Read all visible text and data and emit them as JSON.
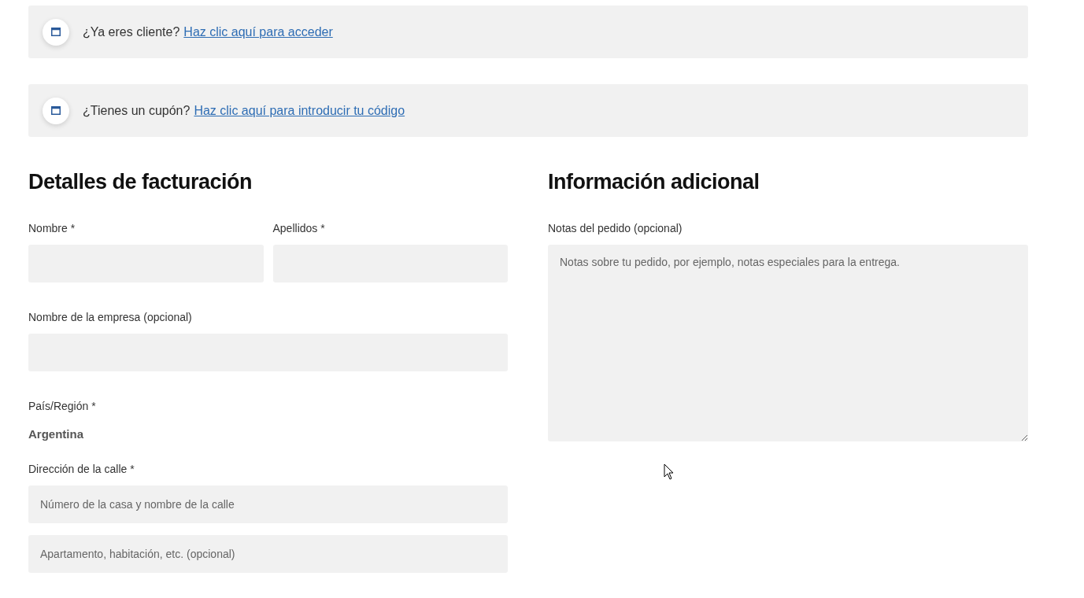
{
  "notices": [
    {
      "text": "¿Ya eres cliente?",
      "link": "Haz clic aquí para acceder"
    },
    {
      "text": "¿Tienes un cupón?",
      "link": "Haz clic aquí para introducir tu código"
    }
  ],
  "billing": {
    "title": "Detalles de facturación",
    "rows": [
      [
        {
          "kind": "input",
          "label": "Nombre *"
        },
        {
          "kind": "input",
          "label": "Apellidos *"
        }
      ],
      [
        {
          "kind": "input",
          "label": "Nombre de la empresa (opcional)"
        }
      ],
      [
        {
          "kind": "static",
          "label": "País/Región *",
          "value": "Argentina"
        }
      ],
      [
        {
          "kind": "input",
          "label": "Dirección de la calle *",
          "inputs": [
            {
              "placeholder": "Número de la casa y nombre de la calle"
            },
            {
              "placeholder": "Apartamento, habitación, etc. (opcional)"
            }
          ]
        }
      ]
    ]
  },
  "additional": {
    "title": "Información adicional",
    "label": "Notas del pedido (opcional)",
    "placeholder": "Notas sobre tu pedido, por ejemplo, notas especiales para la entrega."
  }
}
